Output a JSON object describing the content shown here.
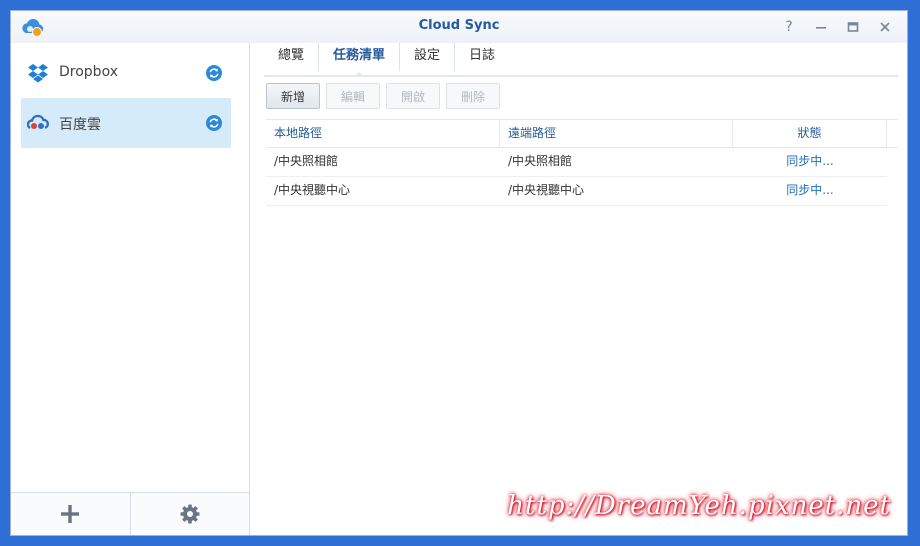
{
  "window": {
    "title": "Cloud Sync",
    "controls": [
      "help-icon",
      "minimize-icon",
      "maximize-icon",
      "close-icon"
    ]
  },
  "sidebar": {
    "providers": [
      {
        "label": "Dropbox",
        "icon": "dropbox-icon",
        "status_icon": "sync-icon",
        "selected": false
      },
      {
        "label": "百度雲",
        "icon": "baidu-cloud-icon",
        "status_icon": "sync-icon",
        "selected": true
      }
    ],
    "footer": {
      "add_icon": "plus-icon",
      "settings_icon": "gear-icon"
    }
  },
  "tabs": [
    {
      "label": "總覽",
      "active": false
    },
    {
      "label": "任務清單",
      "active": true
    },
    {
      "label": "設定",
      "active": false
    },
    {
      "label": "日誌",
      "active": false
    }
  ],
  "toolbar": {
    "add_label": "新增",
    "edit_label": "編輯",
    "open_label": "開啟",
    "delete_label": "刪除"
  },
  "table": {
    "columns": [
      "本地路徑",
      "遠端路徑",
      "狀態"
    ],
    "rows": [
      {
        "local": "/中央照相館",
        "remote": "/中央照相館",
        "status": "同步中..."
      },
      {
        "local": "/中央視聽中心",
        "remote": "/中央視聽中心",
        "status": "同步中..."
      }
    ]
  },
  "watermark": "http://DreamYeh.pixnet.net",
  "colors": {
    "accent": "#245b9e",
    "selected_bg": "#d6ebfa",
    "status_text": "#1f6fb5",
    "desktop": "#2d6fd4"
  }
}
